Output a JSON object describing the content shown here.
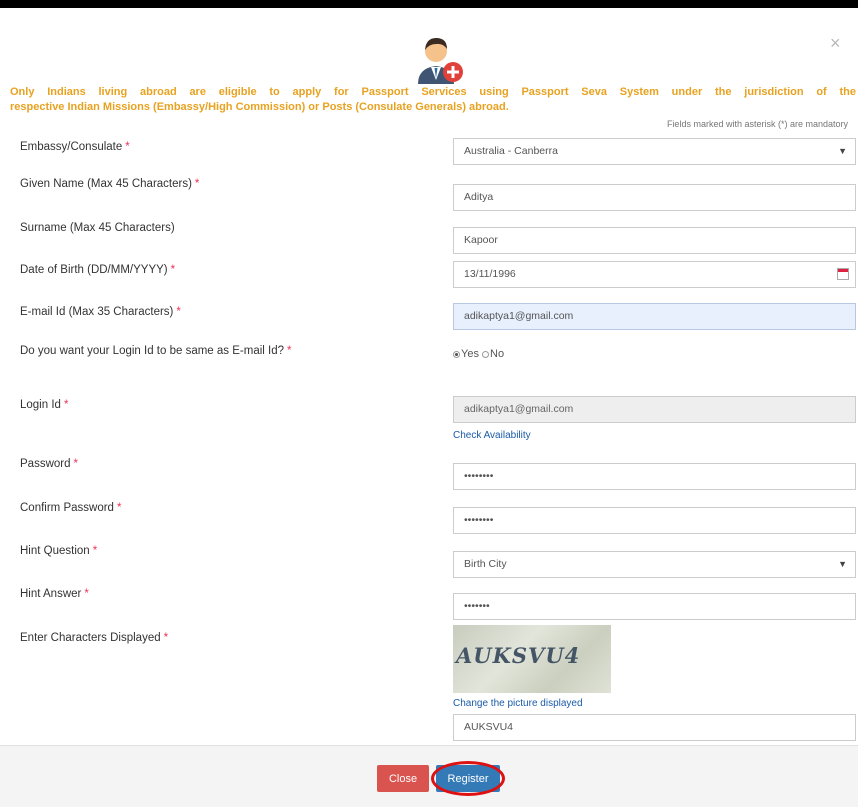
{
  "modal": {
    "notice_line1": "Only Indians living abroad are eligible to apply for Passport Services using Passport Seva System under the jurisdiction of the",
    "notice_line2": "respective Indian Missions (Embassy/High Commission) or Posts (Consulate Generals) abroad.",
    "mandatory_note": "Fields marked with asterisk (*) are mandatory",
    "close_glyph": "×"
  },
  "form": {
    "embassy": {
      "label": "Embassy/Consulate",
      "value": "Australia - Canberra"
    },
    "given_name": {
      "label": "Given Name (Max 45 Characters)",
      "value": "Aditya"
    },
    "surname": {
      "label": "Surname (Max 45 Characters)",
      "value": "Kapoor"
    },
    "dob": {
      "label": "Date of Birth (DD/MM/YYYY)",
      "value": "13/11/1996"
    },
    "email": {
      "label": "E-mail Id (Max 35 Characters)",
      "value": "adikaptya1@gmail.com"
    },
    "login_same": {
      "label": "Do you want your Login Id to be same as E-mail Id?",
      "yes": "Yes",
      "no": "No",
      "selected": "Yes"
    },
    "login_id": {
      "label": "Login Id",
      "value": "adikaptya1@gmail.com",
      "check_link": "Check Availability"
    },
    "password": {
      "label": "Password",
      "value": "••••••••"
    },
    "confirm_password": {
      "label": "Confirm Password",
      "value": "••••••••"
    },
    "hint_question": {
      "label": "Hint Question",
      "value": "Birth City"
    },
    "hint_answer": {
      "label": "Hint Answer",
      "value": "•••••••"
    },
    "captcha": {
      "label": "Enter Characters Displayed",
      "image_text": "AUKSVU4",
      "change_link": "Change the picture displayed",
      "value": "AUKSVU4"
    }
  },
  "footer": {
    "close_label": "Close",
    "register_label": "Register"
  },
  "colors": {
    "notice": "#e8a220",
    "close_button": "#d9534f",
    "register_button": "#337ab7",
    "highlight_ring": "#dd1111"
  },
  "icons": {
    "avatar": "user-add-icon",
    "dropdown": "chevron-down-icon",
    "calendar": "calendar-icon",
    "close": "close-icon"
  }
}
